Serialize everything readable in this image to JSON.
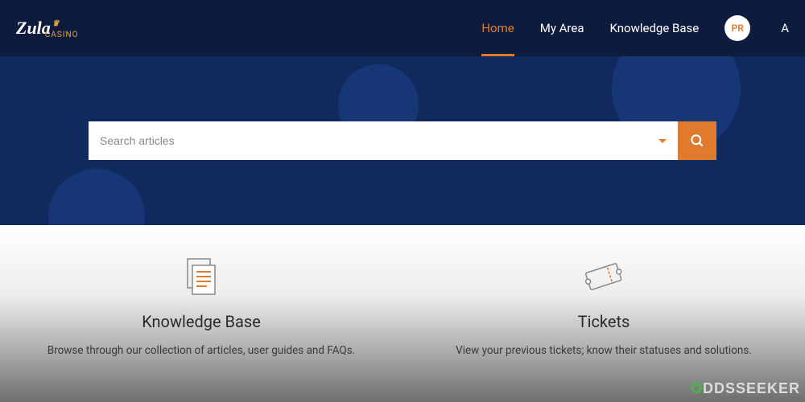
{
  "brand": {
    "name": "Zula",
    "sub": "CASINO"
  },
  "nav": {
    "items": [
      {
        "label": "Home",
        "active": true
      },
      {
        "label": "My Area",
        "active": false
      },
      {
        "label": "Knowledge Base",
        "active": false
      }
    ],
    "avatar_initials": "PR",
    "overflow": "A"
  },
  "search": {
    "placeholder": "Search articles"
  },
  "cards": [
    {
      "title": "Knowledge Base",
      "desc": "Browse through our collection of articles, user guides and FAQs."
    },
    {
      "title": "Tickets",
      "desc": "View your previous tickets; know their statuses and solutions."
    }
  ],
  "watermark": {
    "first": "O",
    "rest": "DDSSEEKER"
  },
  "colors": {
    "accent": "#e07b2e",
    "header": "#0d1b3d",
    "hero": "#102a5e"
  }
}
